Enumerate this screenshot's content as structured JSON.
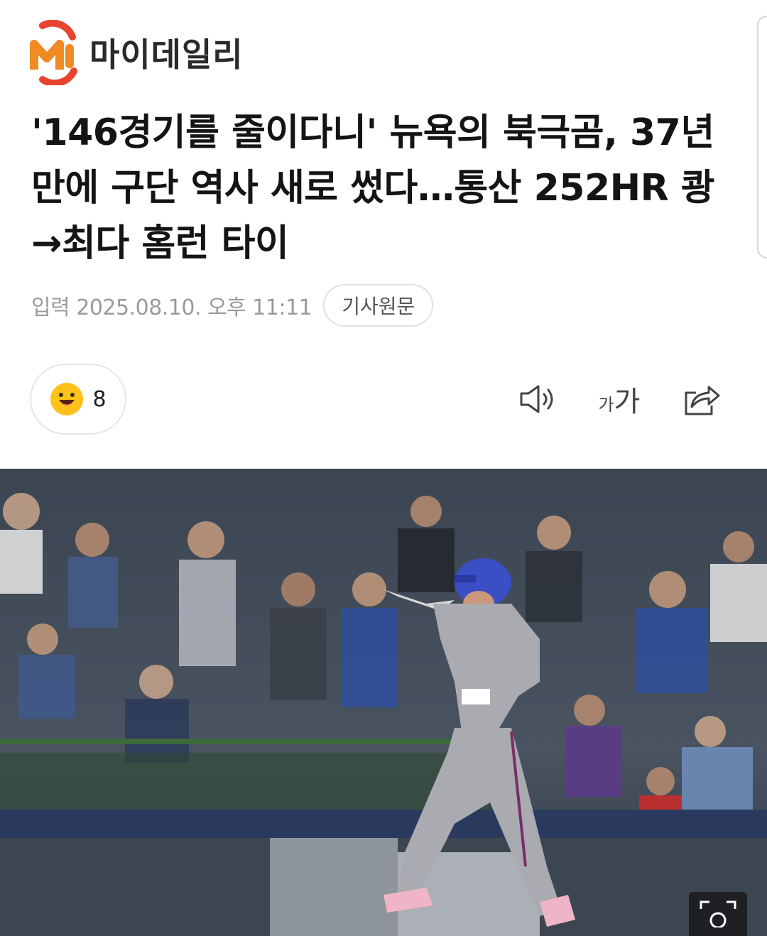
{
  "brand": {
    "name": "마이데일리",
    "colors": {
      "orange": "#F08A24",
      "red": "#E8432F",
      "text": "#2A2A2A"
    }
  },
  "article": {
    "headline": "'146경기를 줄이다니' 뉴욕의 북극곰, 37년 만에 구단 역사 새로 썼다…통산 252HR 쾅→최다 홈런 타이",
    "date": "입력 2025.08.10. 오후 11:11",
    "source_button": "기사원문"
  },
  "reaction": {
    "icon": "smile-emoji-icon",
    "count": "8"
  },
  "toolbar": {
    "audio_icon": "speaker-icon",
    "font_small": "가",
    "font_big": "가",
    "share_icon": "share-icon"
  },
  "photo": {
    "subject": "player-photo",
    "zoom_icon": "zoom-icon"
  }
}
